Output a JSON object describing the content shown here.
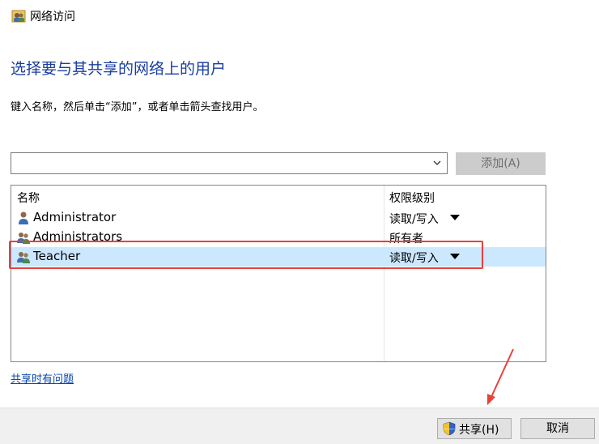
{
  "window": {
    "title": "网络访问"
  },
  "heading": "选择要与其共享的网络上的用户",
  "instruction": "键入名称，然后单击“添加”，或者单击箭头查找用户。",
  "combo": {
    "value": "",
    "placeholder": ""
  },
  "add_button": "添加(A)",
  "list": {
    "headers": {
      "name": "名称",
      "permission": "权限级别"
    },
    "rows": [
      {
        "name": "Administrator",
        "permission": "读取/写入",
        "icon": "user-icon",
        "has_dropdown": true,
        "selected": false
      },
      {
        "name": "Administrators",
        "permission": "所有者",
        "icon": "group-icon",
        "has_dropdown": false,
        "selected": false
      },
      {
        "name": "Teacher",
        "permission": "读取/写入",
        "icon": "group-icon",
        "has_dropdown": true,
        "selected": true
      }
    ]
  },
  "help_link": "共享时有问题",
  "footer": {
    "share_button": "共享(H)",
    "cancel_button": "取消"
  },
  "colors": {
    "heading": "#1a3ea0",
    "selection": "#cce8ff",
    "annotation": "#e8413a",
    "link": "#0645ad"
  }
}
